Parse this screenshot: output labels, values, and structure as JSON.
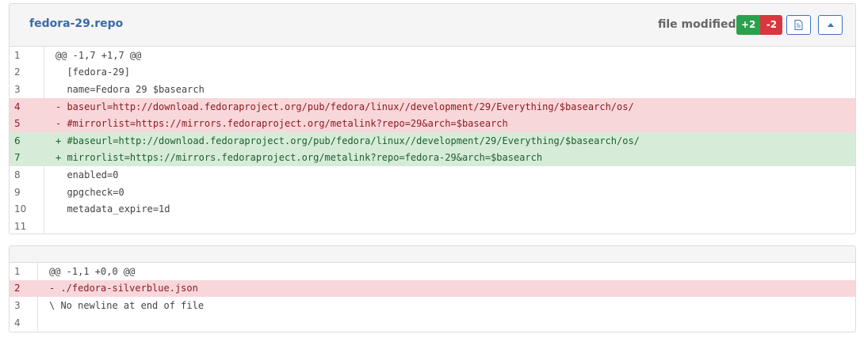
{
  "files": [
    {
      "filename": "fedora-29.repo",
      "status": "file modified",
      "additions": "+2",
      "deletions": "-2",
      "lines": [
        {
          "no": "1",
          "type": "hunk",
          "text": "@@ -1,7 +1,7 @@"
        },
        {
          "no": "2",
          "type": "ctx",
          "text": "  [fedora-29]"
        },
        {
          "no": "3",
          "type": "ctx",
          "text": "  name=Fedora 29 $basearch"
        },
        {
          "no": "4",
          "type": "del",
          "text": "- baseurl=http://download.fedoraproject.org/pub/fedora/linux//development/29/Everything/$basearch/os/"
        },
        {
          "no": "5",
          "type": "del",
          "text": "- #mirrorlist=https://mirrors.fedoraproject.org/metalink?repo=29&arch=$basearch"
        },
        {
          "no": "6",
          "type": "add",
          "text": "+ #baseurl=http://download.fedoraproject.org/pub/fedora/linux//development/29/Everything/$basearch/os/"
        },
        {
          "no": "7",
          "type": "add",
          "text": "+ mirrorlist=https://mirrors.fedoraproject.org/metalink?repo=fedora-29&arch=$basearch"
        },
        {
          "no": "8",
          "type": "ctx",
          "text": "  enabled=0"
        },
        {
          "no": "9",
          "type": "ctx",
          "text": "  gpgcheck=0"
        },
        {
          "no": "10",
          "type": "ctx",
          "text": "  metadata_expire=1d"
        },
        {
          "no": "11",
          "type": "ctx",
          "text": ""
        }
      ]
    },
    {
      "filename": "",
      "lines": [
        {
          "no": "1",
          "type": "hunk",
          "text": "@@ -1,1 +0,0 @@"
        },
        {
          "no": "2",
          "type": "del",
          "text": "- ./fedora-silverblue.json"
        },
        {
          "no": "3",
          "type": "ctx",
          "text": "\\ No newline at end of file"
        },
        {
          "no": "4",
          "type": "ctx",
          "text": ""
        }
      ]
    }
  ],
  "icons": {
    "raw_view": "document-icon",
    "collapse": "caret-up-icon"
  },
  "colors": {
    "add": "#2aa14b",
    "del": "#d9363e",
    "link": "#3b6aa8",
    "button_border": "#3b73b9"
  }
}
